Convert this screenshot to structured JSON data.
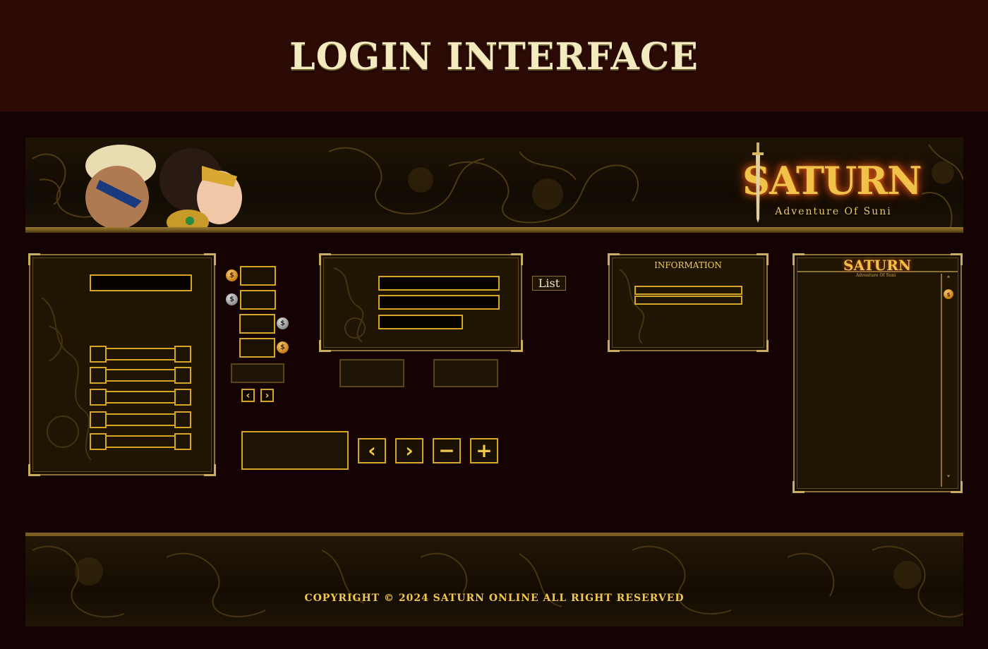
{
  "title": "LOGIN INTERFACE",
  "banner": {
    "logo_title": "SATURN",
    "logo_subtitle": "Adventure Of Suni"
  },
  "server_panel": {
    "slider_count": 5
  },
  "currency_icons": [
    "gold-coin-icon",
    "silver-coin-icon",
    "silver-coin-icon",
    "gold-coin-icon"
  ],
  "buttons": {
    "list_label": "List",
    "prev_small": "‹",
    "next_small": "›",
    "prev": "‹",
    "next": "›",
    "minus": "−",
    "plus": "+"
  },
  "info_panel": {
    "title": "INFORMATION"
  },
  "side_panel": {
    "logo_title": "SATURN",
    "logo_subtitle": "Adventure Of Suni",
    "scroll_up": "˄",
    "scroll_down": "˅"
  },
  "footer": {
    "copyright": "COPYRIGHT © 2024 SATURN ONLINE ALL RIGHT RESERVED"
  },
  "colors": {
    "background": "#150202",
    "title_bar": "#2c0a05",
    "gold": "#d4a623",
    "panel": "#201503"
  }
}
